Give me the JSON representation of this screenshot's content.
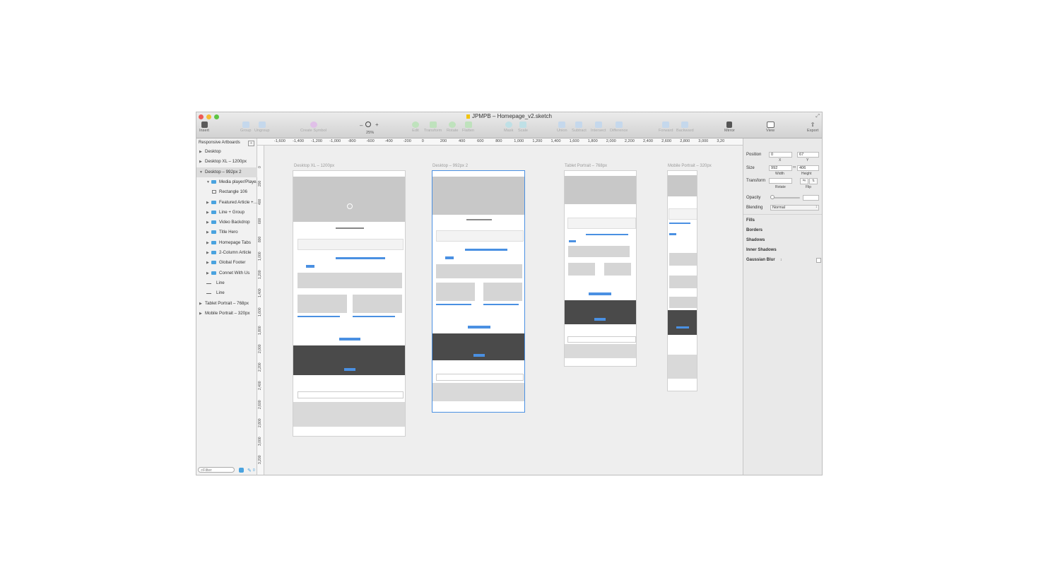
{
  "window": {
    "title": "JPMPB – Homepage_v2.sketch"
  },
  "toolbar": {
    "insert": "Insert",
    "group": "Group",
    "ungroup": "Ungroup",
    "create_symbol": "Create Symbol",
    "zoom_minus": "–",
    "zoom_plus": "+",
    "zoom_level": "25%",
    "edit": "Edit",
    "transform": "Transform",
    "rotate": "Rotate",
    "flatten": "Flatten",
    "mask": "Mask",
    "scale": "Scale",
    "union": "Union",
    "subtract": "Subtract",
    "intersect": "Intersect",
    "difference": "Difference",
    "forward": "Forward",
    "backward": "Backward",
    "mirror": "Mirror",
    "view": "View",
    "export": "Export"
  },
  "sidebar": {
    "page_selector": "Responsive Artboards",
    "layers": [
      {
        "label": "Desktop",
        "type": "page"
      },
      {
        "label": "Desktop XL – 1200px",
        "type": "artboard"
      },
      {
        "label": "Desktop – 992px 2",
        "type": "artboard"
      },
      {
        "label": "Media player/Playe…",
        "type": "group"
      },
      {
        "label": "Rectangle 106",
        "type": "rect"
      },
      {
        "label": "Featured Article +…",
        "type": "group"
      },
      {
        "label": "Line + Group",
        "type": "group"
      },
      {
        "label": "Video Backdrop",
        "type": "group"
      },
      {
        "label": "Title Hero",
        "type": "group"
      },
      {
        "label": "Homepage Tabs",
        "type": "group"
      },
      {
        "label": "2-Column Article",
        "type": "group"
      },
      {
        "label": "Global Footer",
        "type": "group"
      },
      {
        "label": "Connet With Us",
        "type": "group"
      },
      {
        "label": "Line",
        "type": "line"
      },
      {
        "label": "Line",
        "type": "line"
      },
      {
        "label": "Tablet Portrait – 768px",
        "type": "artboard"
      },
      {
        "label": "Mobile Portrait – 320px",
        "type": "artboard"
      }
    ],
    "filter_placeholder": "Filter",
    "filter_count": "0"
  },
  "ruler": {
    "h_ticks": [
      "-1,600",
      "-1,400",
      "-1,200",
      "-1,000",
      "-800",
      "-600",
      "-400",
      "-200",
      "0",
      "200",
      "400",
      "600",
      "800",
      "1,000",
      "1,200",
      "1,400",
      "1,600",
      "1,800",
      "2,000",
      "2,200",
      "2,400",
      "2,600",
      "2,800",
      "3,000",
      "3,20"
    ],
    "v_ticks": [
      "0",
      "200",
      "400",
      "600",
      "800",
      "1,000",
      "1,200",
      "1,400",
      "1,600",
      "1,800",
      "2,000",
      "2,200",
      "2,400",
      "2,600",
      "2,800",
      "3,000",
      "3,200"
    ]
  },
  "artboards": [
    {
      "label": "Desktop XL – 1200px"
    },
    {
      "label": "Desktop – 992px 2"
    },
    {
      "label": "Tablet Portrait – 768px"
    },
    {
      "label": "Mobile Portrait – 320px"
    }
  ],
  "inspector": {
    "position_label": "Position",
    "pos_x": "0",
    "pos_y": "67",
    "x_label": "X",
    "y_label": "Y",
    "size_label": "Size",
    "width": "992",
    "height": "406",
    "width_label": "Width",
    "height_label": "Height",
    "transform_label": "Transform",
    "rotate_label": "Rotate",
    "flip_label": "Flip",
    "opacity_label": "Opacity",
    "blending_label": "Blending",
    "blending_value": "Normal",
    "fills": "Fills",
    "borders": "Borders",
    "shadows": "Shadows",
    "inner_shadows": "Inner Shadows",
    "gaussian_blur": "Gaussian Blur"
  },
  "colors": {
    "accent": "#4a90e2",
    "selected_folder": "#4aa3df",
    "dark_band": "#4a4a4a",
    "hero_gray": "#c8c8c8"
  }
}
